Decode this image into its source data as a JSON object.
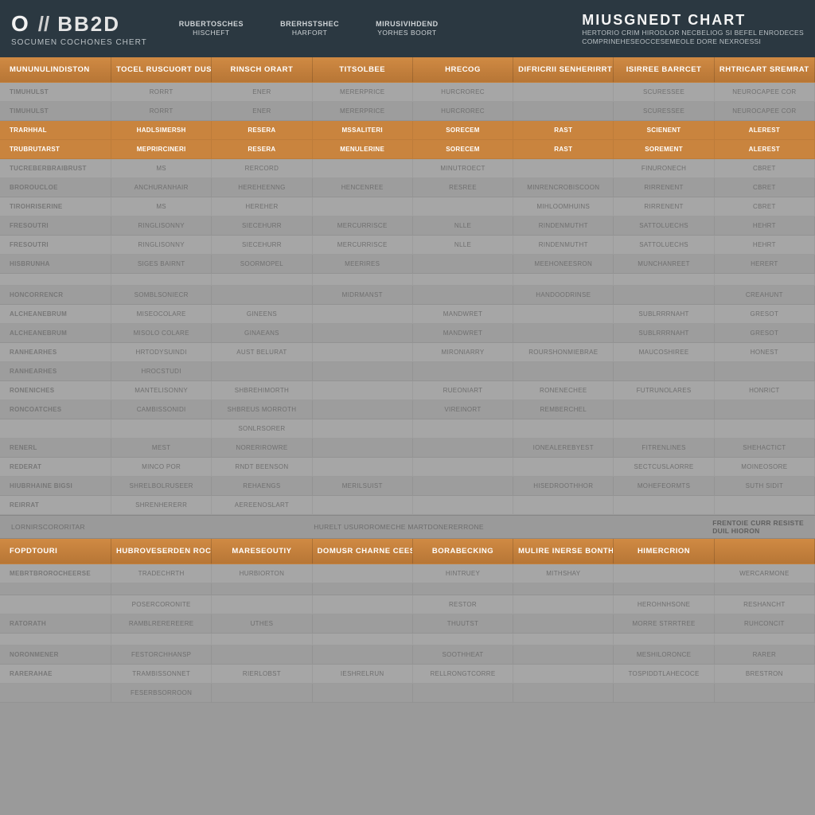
{
  "header": {
    "logo_primary": "O",
    "logo_slash": "//",
    "logo_secondary": "BB2D",
    "logo_sub": "SOCUMEN COCHONES CHERT",
    "tabs": [
      {
        "t1": "RUBERTOSCHES",
        "t2": "HISCHEFT"
      },
      {
        "t1": "BRERHSTSHEC",
        "t2": "HARFORT"
      },
      {
        "t1": "MIRUSIVIHDEND",
        "t2": "YORHES BOORT"
      }
    ],
    "title": "MIUSGNEDT CHART",
    "desc1": "HERTORIO CRIM HIRODLOR NECBELIOG SI BEFEL ENRODECES",
    "desc2": "COMPRINEHESEOCCESEMEOLE DORE NEXROESSI"
  },
  "band1": {
    "rowlabel": "MUNUNULINDISTON",
    "cols": [
      "TOCEL RUSCUORT DUSFELAIMRENT",
      "RINSCH ORART",
      "TITSOLBEE",
      "HRECOG",
      "DIFRICRII SENHERIRRT",
      "ISIRREE BARRCET",
      "RHTRICART SREMRAT"
    ]
  },
  "section1_rows": [
    {
      "z": "a",
      "accent": false,
      "label": "TIMUHULST",
      "c": [
        "RORRT",
        "ENER",
        "MERERPRICE",
        "HURCROREC",
        "",
        "SCURESSEE",
        "NEUROCAPEE  COR"
      ]
    },
    {
      "z": "b",
      "accent": false,
      "label": "TIMUHULST",
      "c": [
        "RORRT",
        "ENER",
        "MERERPRICE",
        "HURCROREC",
        "",
        "SCURESSEE",
        "NEUROCAPEE  COR"
      ]
    },
    {
      "z": "a",
      "accent": true,
      "label": "TRARHHAL",
      "c": [
        "HADLSIMERSH",
        "RESERA",
        "MSSALITERI",
        "SORECEM",
        "RAST",
        "SCIENENT",
        "ALEREST"
      ]
    },
    {
      "z": "b",
      "accent": true,
      "label": "TRUBRUTARST",
      "c": [
        "MEPRIRCINERI",
        "RESERA",
        "MENULERINE",
        "SORECEM",
        "RAST",
        "SOREMENT",
        "ALEREST"
      ]
    },
    {
      "z": "a",
      "accent": false,
      "label": "TUCREBERBRAIBRUST",
      "c": [
        "MS",
        "RERCORD",
        "",
        "MINUTROECT",
        "",
        "FINURONECH",
        "CBRET"
      ]
    },
    {
      "z": "b",
      "accent": false,
      "label": "BROROUCLOE",
      "c": [
        "ANCHURANHAIR",
        "HEREHEENNG",
        "HENCENREE",
        "RESREE",
        "MINRENCROBISCOON",
        "RIRRENENT",
        "CBRET"
      ]
    },
    {
      "z": "a",
      "accent": false,
      "label": "TIROHRISERINE",
      "c": [
        "MS",
        "HEREHER",
        "",
        "",
        "MIHLOOMHUINS",
        "RIRRENENT",
        "CBRET"
      ]
    },
    {
      "z": "b",
      "accent": false,
      "label": "FRESOUTRI",
      "c": [
        "RINGLISONNY",
        "SIECEHURR",
        "MERCURRISCE",
        "NLLE",
        "RINDENMUTHT",
        "SATTOLUECHS",
        "HEHRT"
      ]
    },
    {
      "z": "a",
      "accent": false,
      "label": "FRESOUTRI",
      "c": [
        "RINGLISONNY",
        "SIECEHURR",
        "MERCURRISCE",
        "NLLE",
        "RINDENMUTHT",
        "SATTOLUECHS",
        "HEHRT"
      ]
    },
    {
      "z": "b",
      "accent": false,
      "label": "HISBRUNHA",
      "c": [
        "SIGES BAIRNT",
        "SOORMOPEL",
        "MEERIRES",
        "",
        "MEEHONEESRON",
        "MUNCHANREET",
        "HERERT"
      ]
    },
    {
      "z": "a",
      "accent": false,
      "label": "",
      "c": [
        "",
        "",
        "",
        "",
        "",
        "",
        ""
      ]
    },
    {
      "z": "b",
      "accent": false,
      "label": "HONCORRENCR",
      "c": [
        "SOMBLSONIECR",
        "",
        "MIDRMANST",
        "",
        "HANDOODRINSE",
        "",
        "CREAHUNT"
      ]
    },
    {
      "z": "a",
      "accent": false,
      "label": "ALCHEANEBRUM",
      "c": [
        "MISEOCOLARE",
        "GINEENS",
        "",
        "MANDWRET",
        "",
        "SUBLRRRNAHT",
        "GRESOT"
      ]
    },
    {
      "z": "b",
      "accent": false,
      "label": "ALCHEANEBRUM",
      "c": [
        "MISOLO COLARE",
        "GINAEANS",
        "",
        "MANDWRET",
        "",
        "SUBLRRRNAHT",
        "GRESOT"
      ]
    },
    {
      "z": "a",
      "accent": false,
      "label": "RANHEARHES",
      "c": [
        "HRTODYSUINDI",
        "AUST BELURAT",
        "",
        "MIRONIARRY",
        "ROURSHONMIEBRAE",
        "MAUCOSHIREE",
        "HONEST"
      ]
    },
    {
      "z": "b",
      "accent": false,
      "label": "RANHEARHES",
      "c": [
        "HROCSTUDI",
        "",
        "",
        "",
        "",
        "",
        ""
      ]
    },
    {
      "z": "a",
      "accent": false,
      "label": "RONENICHES",
      "c": [
        "MANTELISONNY",
        "SHBREHIMORTH",
        "",
        "RUEONIART",
        "RONENECHEE",
        "FUTRUNOLARES",
        "HONRICT"
      ]
    },
    {
      "z": "b",
      "accent": false,
      "label": "RONCOATCHES",
      "c": [
        "CAMBISSONIDI",
        "SHBREUS MORROTH",
        "",
        "VIREINORT",
        "REMBERCHEL",
        "",
        ""
      ]
    },
    {
      "z": "a",
      "accent": false,
      "label": "",
      "c": [
        "",
        "SONLRSORER",
        "",
        "",
        "",
        "",
        ""
      ]
    },
    {
      "z": "b",
      "accent": false,
      "label": "RENERL",
      "c": [
        "MEST",
        "NORERIROWRE",
        "",
        "",
        "IONEALEREBYEST",
        "FITRENLINES",
        "SHEHACTICT"
      ]
    },
    {
      "z": "a",
      "accent": false,
      "label": "REDERAT",
      "c": [
        "MINCO POR",
        "RNDT BEENSON",
        "",
        "",
        "",
        "SECTCUSLAORRE",
        "MOINEOSORE"
      ]
    },
    {
      "z": "b",
      "accent": false,
      "label": "HIUBRHAINE BIGSI",
      "c": [
        "SHRELBOLRUSEER",
        "REHAENGS",
        "MERILSUIST",
        "",
        "HISEDROOTHHOR",
        "MOHEFEORMTS",
        "SUTH SIDIT"
      ]
    },
    {
      "z": "a",
      "accent": false,
      "label": "REIRRAT",
      "c": [
        "SHRENHERERR",
        "AEREENOSLART",
        "",
        "",
        "",
        "",
        ""
      ]
    }
  ],
  "section_gap": {
    "left": "LORNIRSCORORITAR",
    "mid": "HURELT USUROROMECHE  MARTDONERERRONE",
    "right_t1": "FRENTOIE CURR RESISTE",
    "right_t2": "DUIL HIORON"
  },
  "band2_toplabel": "",
  "band2": {
    "rowlabel": "FOPDTOURI",
    "cols": [
      "HUBROVESERDEN ROCKLONG",
      "MARESEOUTIY",
      "DOMUSR CHARNE CEESEHORE",
      "BORABECKING",
      "MULIRE INERSE BONTHERER",
      "HIMERCRION"
    ]
  },
  "section2_rows": [
    {
      "z": "a",
      "label": "MEBRTBROROCHEERSE",
      "c": [
        "TRADECHRTH",
        "HURBIORTON",
        "",
        "HINTRUEY",
        "MITHSHAY",
        "",
        "WERCARMONE"
      ]
    },
    {
      "z": "b",
      "label": "",
      "c": [
        "",
        "",
        "",
        "",
        "",
        "",
        ""
      ]
    },
    {
      "z": "a",
      "label": "",
      "c": [
        "POSERCORONITE",
        "",
        "",
        "RESTOR",
        "",
        "HEROHNHSONE",
        "RESHANCHT"
      ]
    },
    {
      "z": "b",
      "label": "RATORATH",
      "c": [
        "RAMBLREREREERE",
        "UTHES",
        "",
        "THUUTST",
        "",
        "MORRE STRRTREE",
        "RUHCONCIT"
      ]
    },
    {
      "z": "a",
      "label": "",
      "c": [
        "",
        "",
        "",
        "",
        "",
        "",
        ""
      ]
    },
    {
      "z": "b",
      "label": "NORONMENER",
      "c": [
        "FESTORCHHANSP",
        "",
        "",
        "SOOTHHEAT",
        "",
        "MESHILORONCE",
        "RARER"
      ]
    },
    {
      "z": "a",
      "label": "RARERAHAE",
      "c": [
        "TRAMBISSONNET",
        "RIERLOBST",
        "IESHRELRUN",
        "RELLRONGTCORRE",
        "",
        "TOSPIDDTLAHECOCE",
        "BRESTRON"
      ]
    },
    {
      "z": "b",
      "label": "",
      "c": [
        "FESERBSORROON",
        "",
        "",
        "",
        "",
        "",
        ""
      ]
    }
  ]
}
